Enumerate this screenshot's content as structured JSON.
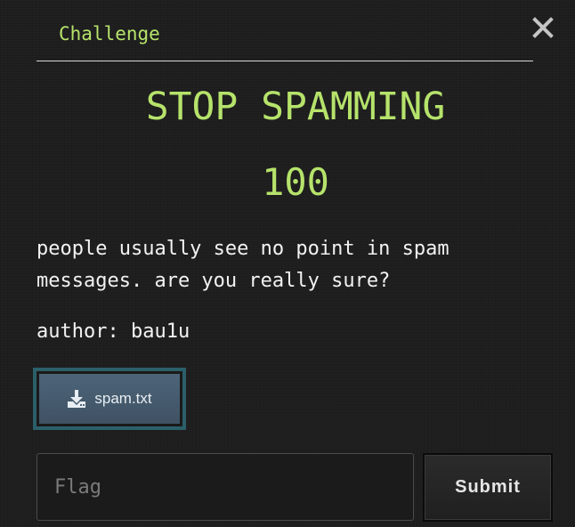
{
  "tabs": [
    {
      "label": "Challenge",
      "active": true
    }
  ],
  "challenge": {
    "name": "STOP SPAMMING",
    "points": "100",
    "description": "people usually see no point in spam messages. are you really sure?",
    "author": "author: bau1u"
  },
  "files": [
    {
      "name": "spam.txt",
      "icon": "download-icon"
    }
  ],
  "flag_form": {
    "placeholder": "Flag",
    "value": "",
    "submit_label": "Submit"
  },
  "icons": {
    "close": "close-icon",
    "download": "download-icon"
  },
  "colors": {
    "accent_green": "#b6e36b",
    "background": "#1e1e1e",
    "file_button_border": "#2b5f69",
    "file_button_fill": "#4d6478"
  }
}
